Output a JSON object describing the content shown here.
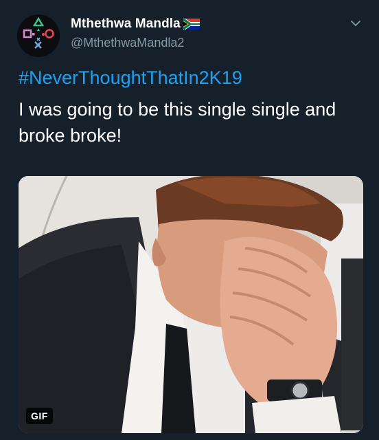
{
  "tweet": {
    "display_name": "Mthethwa Mandla",
    "handle": "@MthethwaMandla2",
    "hashtag": "#NeverThoughtThatIn2K19",
    "text": "I was going to be this single single and broke broke!",
    "media": {
      "type": "gif",
      "badge": "GIF"
    }
  },
  "icons": {
    "avatar": "playstation-symbols-avatar",
    "flag": "south-africa-flag-icon",
    "menu": "chevron-down-icon"
  },
  "colors": {
    "background": "#15202b",
    "name": "#ffffff",
    "handle": "#8899a6",
    "hashtag": "#1da1f2",
    "text": "#ffffff"
  }
}
